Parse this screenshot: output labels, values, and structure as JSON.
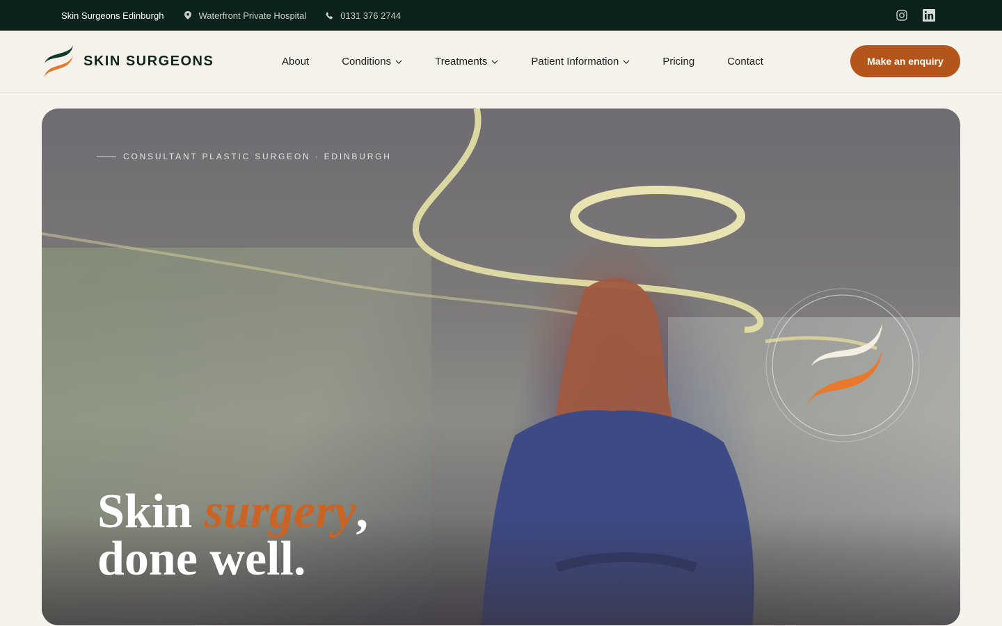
{
  "topbar": {
    "brand": "Skin Surgeons Edinburgh",
    "location": "Waterfront Private Hospital",
    "phone": "0131 376 2744",
    "location_icon": "map-pin-icon",
    "phone_icon": "phone-icon",
    "socials": [
      "instagram-icon",
      "linkedin-icon"
    ]
  },
  "header": {
    "logo_text": "SKIN SURGEONS",
    "nav": [
      {
        "label": "About",
        "dropdown": false
      },
      {
        "label": "Conditions",
        "dropdown": true
      },
      {
        "label": "Treatments",
        "dropdown": true
      },
      {
        "label": "Patient Information",
        "dropdown": true
      },
      {
        "label": "Pricing",
        "dropdown": false
      },
      {
        "label": "Contact",
        "dropdown": false
      }
    ],
    "cta_label": "Make an enquiry"
  },
  "hero": {
    "eyebrow": "CONSULTANT PLASTIC SURGEON · EDINBURGH",
    "headline_start": "Skin ",
    "headline_accent": "surgery",
    "headline_comma": ",",
    "headline_line2": "done well."
  },
  "colors": {
    "topbar_bg": "#0b2319",
    "page_bg": "#f5f2eb",
    "accent_orange": "#b4561b",
    "brand_green": "#0f3a2a",
    "headline_accent": "#c96424"
  }
}
